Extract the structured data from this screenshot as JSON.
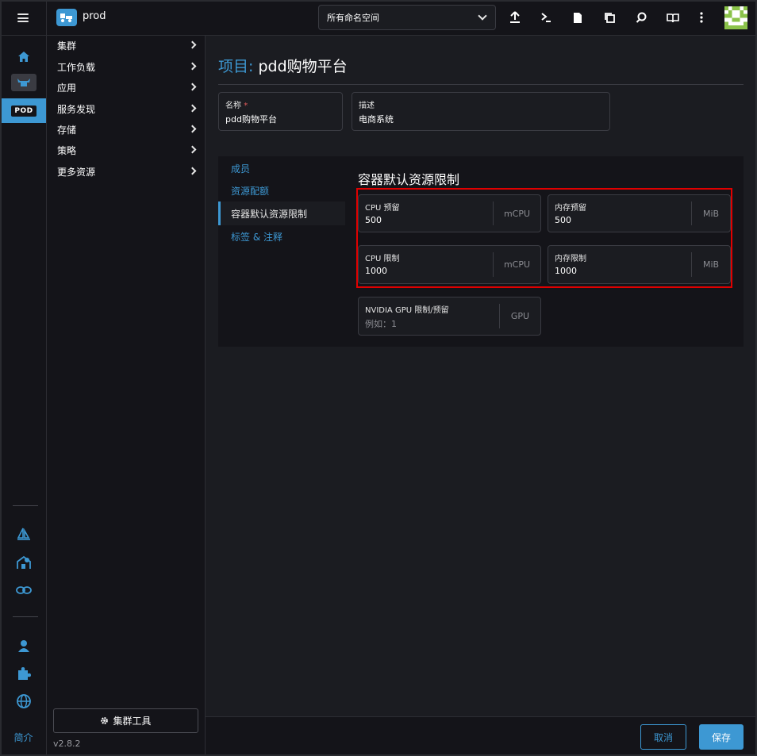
{
  "header": {
    "cluster_name": "prod",
    "namespace_selected": "所有命名空间",
    "icons": [
      "upload-icon",
      "terminal-icon",
      "file-icon",
      "copy-icon",
      "search-icon",
      "book-icon",
      "more-vertical-icon"
    ]
  },
  "rail": {
    "pod_label": "POD",
    "about_label": "简介"
  },
  "sidenav": {
    "items": [
      {
        "label": "集群"
      },
      {
        "label": "工作负载"
      },
      {
        "label": "应用"
      },
      {
        "label": "服务发现"
      },
      {
        "label": "存储"
      },
      {
        "label": "策略"
      },
      {
        "label": "更多资源"
      }
    ],
    "cluster_tools_label": "集群工具",
    "version": "v2.8.2"
  },
  "page": {
    "title_prefix": "项目:",
    "title_name": "pdd购物平台",
    "name_field": {
      "label": "名称",
      "required_mark": "*",
      "value": "pdd购物平台"
    },
    "description_field": {
      "label": "描述",
      "value": "电商系统"
    },
    "tabs": [
      {
        "label": "成员",
        "active": false
      },
      {
        "label": "资源配额",
        "active": false
      },
      {
        "label": "容器默认资源限制",
        "active": true
      },
      {
        "label": "标签 & 注释",
        "active": false
      }
    ],
    "section_title": "容器默认资源限制",
    "limits": {
      "cpu_reservation": {
        "label": "CPU 预留",
        "value": "500",
        "unit": "mCPU"
      },
      "memory_reservation": {
        "label": "内存预留",
        "value": "500",
        "unit": "MiB"
      },
      "cpu_limit": {
        "label": "CPU 限制",
        "value": "1000",
        "unit": "mCPU"
      },
      "memory_limit": {
        "label": "内存限制",
        "value": "1000",
        "unit": "MiB"
      },
      "gpu": {
        "label": "NVIDIA GPU 限制/预留",
        "placeholder": "例如：1",
        "unit": "GPU"
      }
    }
  },
  "footer": {
    "cancel_label": "取消",
    "save_label": "保存"
  },
  "colors": {
    "accent": "#3d98d3",
    "highlight": "#e00000",
    "background": "#1b1c21",
    "panel": "#141419"
  }
}
